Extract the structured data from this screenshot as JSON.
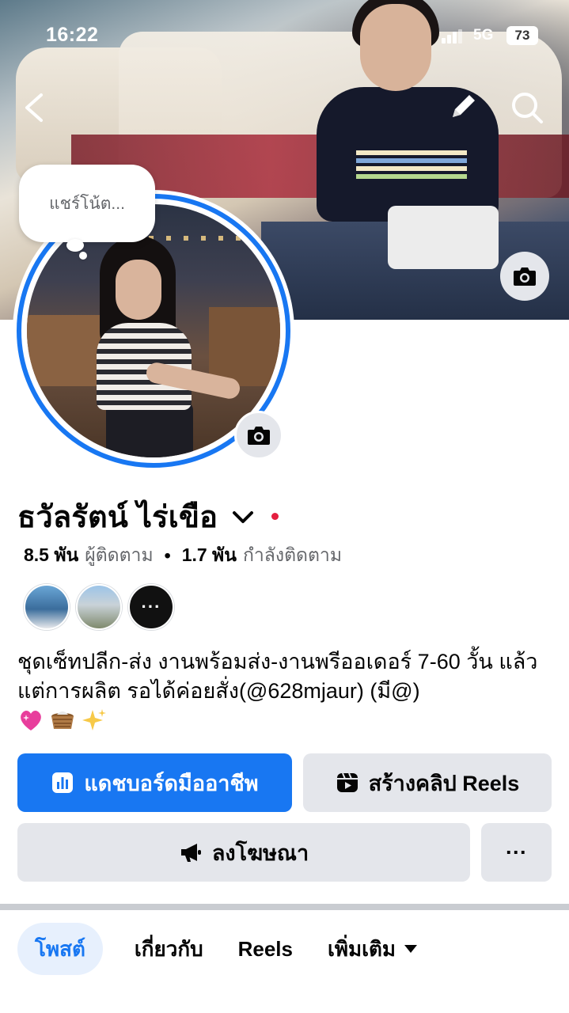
{
  "status_bar": {
    "time": "16:22",
    "network": "5G",
    "battery": "73"
  },
  "cover": {
    "note_placeholder": "แชร์โน้ต..."
  },
  "profile": {
    "name": "ธวัลรัตน์ ไร่เขือ",
    "followers_count": "8.5 พัน",
    "followers_label": "ผู้ติดตาม",
    "following_count": "1.7 พัน",
    "following_label": "กำลังติดตาม",
    "bio": "ชุดเซ็ทปลีก-ส่ง งานพร้อมส่ง-งานพรีออเดอร์ 7-60 วั้น แล้วแต่การผลิต รอได้ค่อยสั่ง(@628mjaur) (มี@)",
    "friends_more": "···"
  },
  "actions": {
    "dashboard_label": "แดชบอร์ดมืออาชีพ",
    "reels_label": "สร้างคลิป Reels",
    "ads_label": "ลงโฆษณา",
    "more_label": "···"
  },
  "tabs": [
    {
      "label": "โพสต์"
    },
    {
      "label": "เกี่ยวกับ"
    },
    {
      "label": "Reels"
    },
    {
      "label": "เพิ่มเติม"
    }
  ],
  "colors": {
    "accent": "#1877f2",
    "button_gray": "#e4e6eb",
    "red_dot": "#e41e3f"
  }
}
